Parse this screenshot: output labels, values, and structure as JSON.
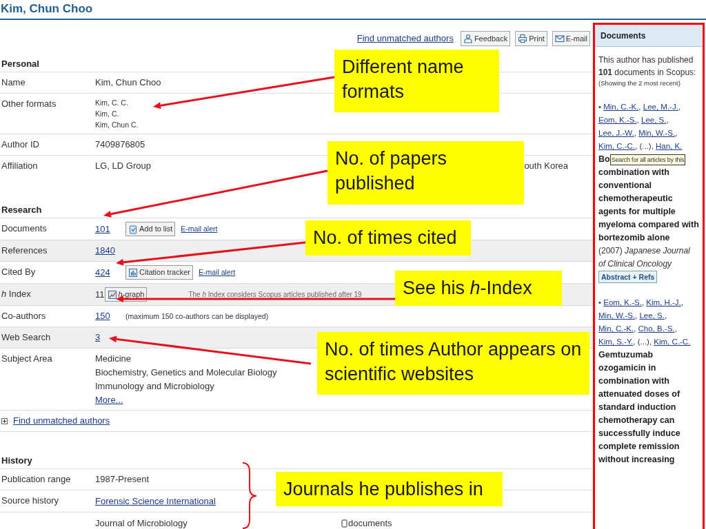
{
  "page_title": "Kim, Chun Choo",
  "toolbar": {
    "link": "Find unmatched authors",
    "buttons": [
      {
        "kind": "feedback",
        "label": "Feedback"
      },
      {
        "kind": "print",
        "label": "Print"
      },
      {
        "kind": "email",
        "label": "E-mail"
      }
    ]
  },
  "blocks": [
    {
      "kind": "section",
      "heading": "Personal",
      "rows": [
        {
          "label": "Name",
          "shaded": false,
          "lines": [
            [
              {
                "kind": "text",
                "text": "Kim, Chun Choo"
              }
            ]
          ]
        },
        {
          "label": "Other formats",
          "shaded": false,
          "lines": [
            [
              {
                "kind": "small",
                "text": "Kim, C. C."
              }
            ],
            [
              {
                "kind": "small",
                "text": "Kim, C."
              }
            ],
            [
              {
                "kind": "small",
                "text": "Kim, Chun C."
              }
            ]
          ]
        },
        {
          "label": "Author ID",
          "shaded": false,
          "lines": [
            [
              {
                "kind": "text",
                "text": "7409876805"
              }
            ]
          ]
        },
        {
          "label": "Affiliation",
          "shaded": false,
          "lines": [
            [
              {
                "kind": "text",
                "text": "LG, LD Group"
              },
              {
                "kind": "far",
                "text": "outh Korea"
              }
            ]
          ]
        }
      ]
    },
    {
      "kind": "section",
      "heading": "Research",
      "rows": [
        {
          "label": "Documents",
          "shaded": false,
          "lines": [
            [
              {
                "kind": "link",
                "text": "101"
              },
              {
                "kind": "add_button",
                "text": "Add to list"
              },
              {
                "kind": "small_link",
                "text": "E-mail alert"
              }
            ]
          ]
        },
        {
          "label": "References",
          "shaded": true,
          "lines": [
            [
              {
                "kind": "link",
                "text": "1840"
              }
            ]
          ]
        },
        {
          "label": "Cited By",
          "shaded": false,
          "lines": [
            [
              {
                "kind": "link",
                "text": "424"
              },
              {
                "kind": "tracker_button",
                "text": "Citation tracker"
              },
              {
                "kind": "small_link",
                "text": "E-mail alert"
              }
            ]
          ]
        },
        {
          "label": "*h* Index",
          "shaded": true,
          "lines": [
            [
              {
                "kind": "text",
                "text": "11"
              },
              {
                "kind": "graph_button",
                "text": "*h*-graph"
              },
              {
                "kind": "note",
                "text": "The *h* Index considers Scopus articles published after 19"
              }
            ]
          ]
        },
        {
          "label": "Co-authors",
          "shaded": false,
          "lines": [
            [
              {
                "kind": "link",
                "text": "150"
              },
              {
                "kind": "small",
                "text": "(maximum 150 co-authors can be displayed)"
              }
            ]
          ]
        },
        {
          "label": "Web Search",
          "shaded": true,
          "lines": [
            [
              {
                "kind": "link",
                "text": "3"
              }
            ]
          ]
        },
        {
          "label": "Subject Area",
          "shaded": false,
          "lines": [
            [
              {
                "kind": "text",
                "text": "Medicine"
              }
            ],
            [
              {
                "kind": "text",
                "text": "Biochemistry, Genetics and Molecular Biology"
              }
            ],
            [
              {
                "kind": "text",
                "text": "Immunology and Microbiology"
              }
            ],
            [
              {
                "kind": "link",
                "text": "More..."
              }
            ]
          ]
        }
      ]
    },
    {
      "kind": "expander",
      "label": "Find unmatched authors",
      "expanded": false
    },
    {
      "kind": "section",
      "heading": "History",
      "rows": [
        {
          "label": "Publication range",
          "shaded": false,
          "lines": [
            [
              {
                "kind": "text",
                "text": "1987-Present"
              }
            ]
          ]
        },
        {
          "label": "Source history",
          "shaded": false,
          "lines": [
            [
              {
                "kind": "journal_link",
                "text": "Forensic Science International"
              }
            ]
          ]
        },
        {
          "shaded": false,
          "lines": [
            [
              {
                "kind": "journal",
                "text": "Journal of Microbiology"
              },
              {
                "kind": "doc_link",
                "text": "documents"
              }
            ]
          ]
        }
      ]
    }
  ],
  "documents_panel": {
    "title": "Documents",
    "summary": "This author has published **101** documents in Scopus:",
    "note": "(Showing the 2 most recent)",
    "articles": [
      {
        "bullet": "•",
        "authors": [
          {
            "text": "Min, C.-K.",
            "link": true,
            "after": ","
          },
          {
            "text": "Lee, M.-J.",
            "link": true,
            "after": ","
          },
          {
            "text": "Eom, K.-S.",
            "link": true,
            "after": ","
          },
          {
            "text": "Lee, S.",
            "link": true,
            "after": ","
          },
          {
            "text": "Lee, J.-W.",
            "link": true,
            "after": ","
          },
          {
            "text": "Min, W.-S.",
            "link": true,
            "after": ","
          },
          {
            "text": "Kim, C.-C.",
            "link": true,
            "after": ","
          },
          {
            "text": "(...)",
            "link": false,
            "after": ","
          },
          {
            "text": "Han, K.",
            "link": true
          }
        ],
        "title_start": "Bo",
        "tooltip": "Search for all articles by this",
        "title_rest": "combination with conventional chemotherapeutic agents for multiple myeloma compared with bortezomib alone",
        "source": "(2007) *Japanese Journal of Clinical Oncology*",
        "button": "Abstract + Refs"
      },
      {
        "bullet": "•",
        "authors": [
          {
            "text": "Eom, K.-S.",
            "link": true,
            "after": ","
          },
          {
            "text": "Kim, H.-J.",
            "link": true,
            "after": ","
          },
          {
            "text": "Min, W.-S.",
            "link": true,
            "after": ","
          },
          {
            "text": "Lee, S.",
            "link": true,
            "after": ","
          },
          {
            "text": "Min, C.-K.",
            "link": true,
            "after": ","
          },
          {
            "text": "Cho, B.-S.",
            "link": true,
            "after": ","
          },
          {
            "text": "Kim, S.-Y.",
            "link": true,
            "after": ","
          },
          {
            "text": "(...)",
            "link": false,
            "after": ","
          },
          {
            "text": "Kim, C.-C.",
            "link": true
          }
        ],
        "title_rest": "Gemtuzumab ozogamicin in combination with attenuated doses of standard induction chemotherapy can successfully induce complete remission without increasing"
      }
    ]
  },
  "callouts": [
    {
      "text": "Different name formats"
    },
    {
      "text": "No. of papers published"
    },
    {
      "text": "No. of times cited"
    },
    {
      "text": "See his *h*-Index"
    },
    {
      "text": "No. of times Author appears on scientific websites"
    },
    {
      "text": "Journals he publishes in"
    }
  ]
}
